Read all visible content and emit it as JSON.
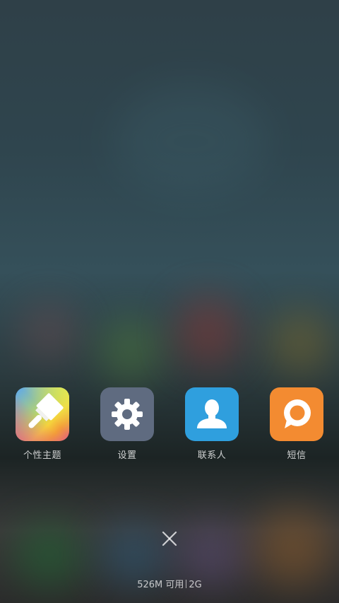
{
  "recent_apps": [
    {
      "label": "个性主题",
      "icon": "paintbrush-icon",
      "color": "#5aa6f2"
    },
    {
      "label": "设置",
      "icon": "gear-icon",
      "color": "#5f6b80"
    },
    {
      "label": "联系人",
      "icon": "person-icon",
      "color": "#2f9fde"
    },
    {
      "label": "短信",
      "icon": "chat-bubble-icon",
      "color": "#f38b31"
    }
  ],
  "close": {
    "icon": "close-icon"
  },
  "memory": {
    "available": "526M 可用",
    "total": "2G"
  }
}
